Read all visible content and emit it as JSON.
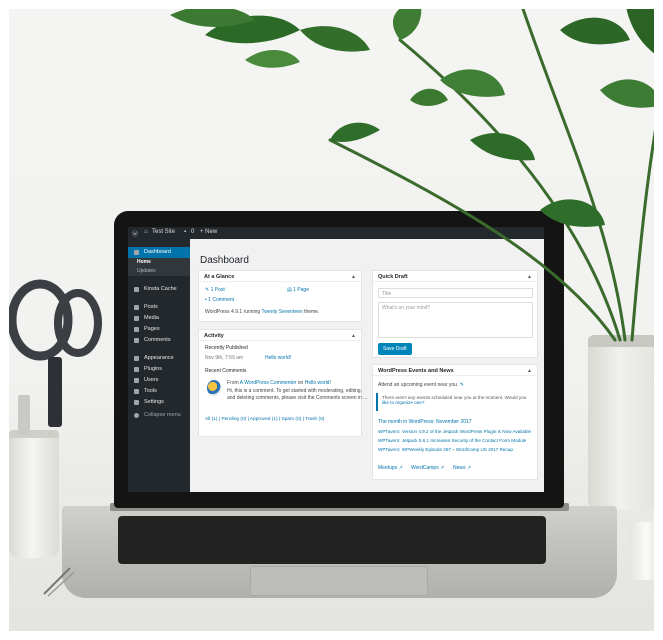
{
  "admin_bar": {
    "site_name": "Test Site",
    "comments_count": "0",
    "new_label": "+ New"
  },
  "sidebar": {
    "items": [
      {
        "label": "Dashboard",
        "active": true
      },
      {
        "label": "Kinsta Cache"
      },
      {
        "label": "Posts"
      },
      {
        "label": "Media"
      },
      {
        "label": "Pages"
      },
      {
        "label": "Comments"
      },
      {
        "label": "Appearance"
      },
      {
        "label": "Plugins"
      },
      {
        "label": "Users"
      },
      {
        "label": "Tools"
      },
      {
        "label": "Settings"
      },
      {
        "label": "Collapse menu"
      }
    ],
    "sub_items": [
      "Home",
      "Updates"
    ]
  },
  "page_title": "Dashboard",
  "at_a_glance": {
    "title": "At a Glance",
    "posts": "1 Post",
    "pages": "1 Page",
    "comments": "1 Comment",
    "version_text": "WordPress 4.9.1 running",
    "theme_link": "Twenty Seventeen",
    "theme_suffix": "theme."
  },
  "activity": {
    "title": "Activity",
    "recently_published": "Recently Published",
    "date": "Nov 9th, 7:59 am",
    "post_link": "Hello world!",
    "recent_comments": "Recent Comments",
    "comment_from": "From",
    "comment_author": "A WordPress Commenter",
    "comment_on": "on",
    "comment_post": "Hello world!",
    "comment_excerpt_1": "Hi, this is a comment. To get started with moderating, editing,",
    "comment_excerpt_2": "and deleting comments, please visit the Comments screen in ...",
    "filters": "All (1) | Pending (0) | Approved (1) | Spam (0) | Trash (0)"
  },
  "quick_draft": {
    "title": "Quick Draft",
    "title_placeholder": "Title",
    "content_placeholder": "What's on your mind?",
    "save_label": "Save Draft"
  },
  "events_news": {
    "title": "WordPress Events and News",
    "attend_text": "Attend an upcoming event near you.",
    "notice_1": "There aren't any events scheduled near you at the moment. Would you",
    "notice_2": "like to organize one?",
    "news": [
      "The month in WordPress: November 2017",
      "WPTavern: Version 4.9.2 of the Jetpack WordPress Plugin is Now Available",
      "WPTavern: Jetpack 5.6.1 Increases Security of the Contact Form Module",
      "WPTavern: WPWeekly Episode 297 – WordCamp US 2017 Recap"
    ],
    "footer_links": [
      "Meetups",
      "WordCamps",
      "News"
    ]
  },
  "colors": {
    "admin_dark": "#23282d",
    "accent": "#0073aa",
    "plant_green": "#2f6d2a"
  }
}
